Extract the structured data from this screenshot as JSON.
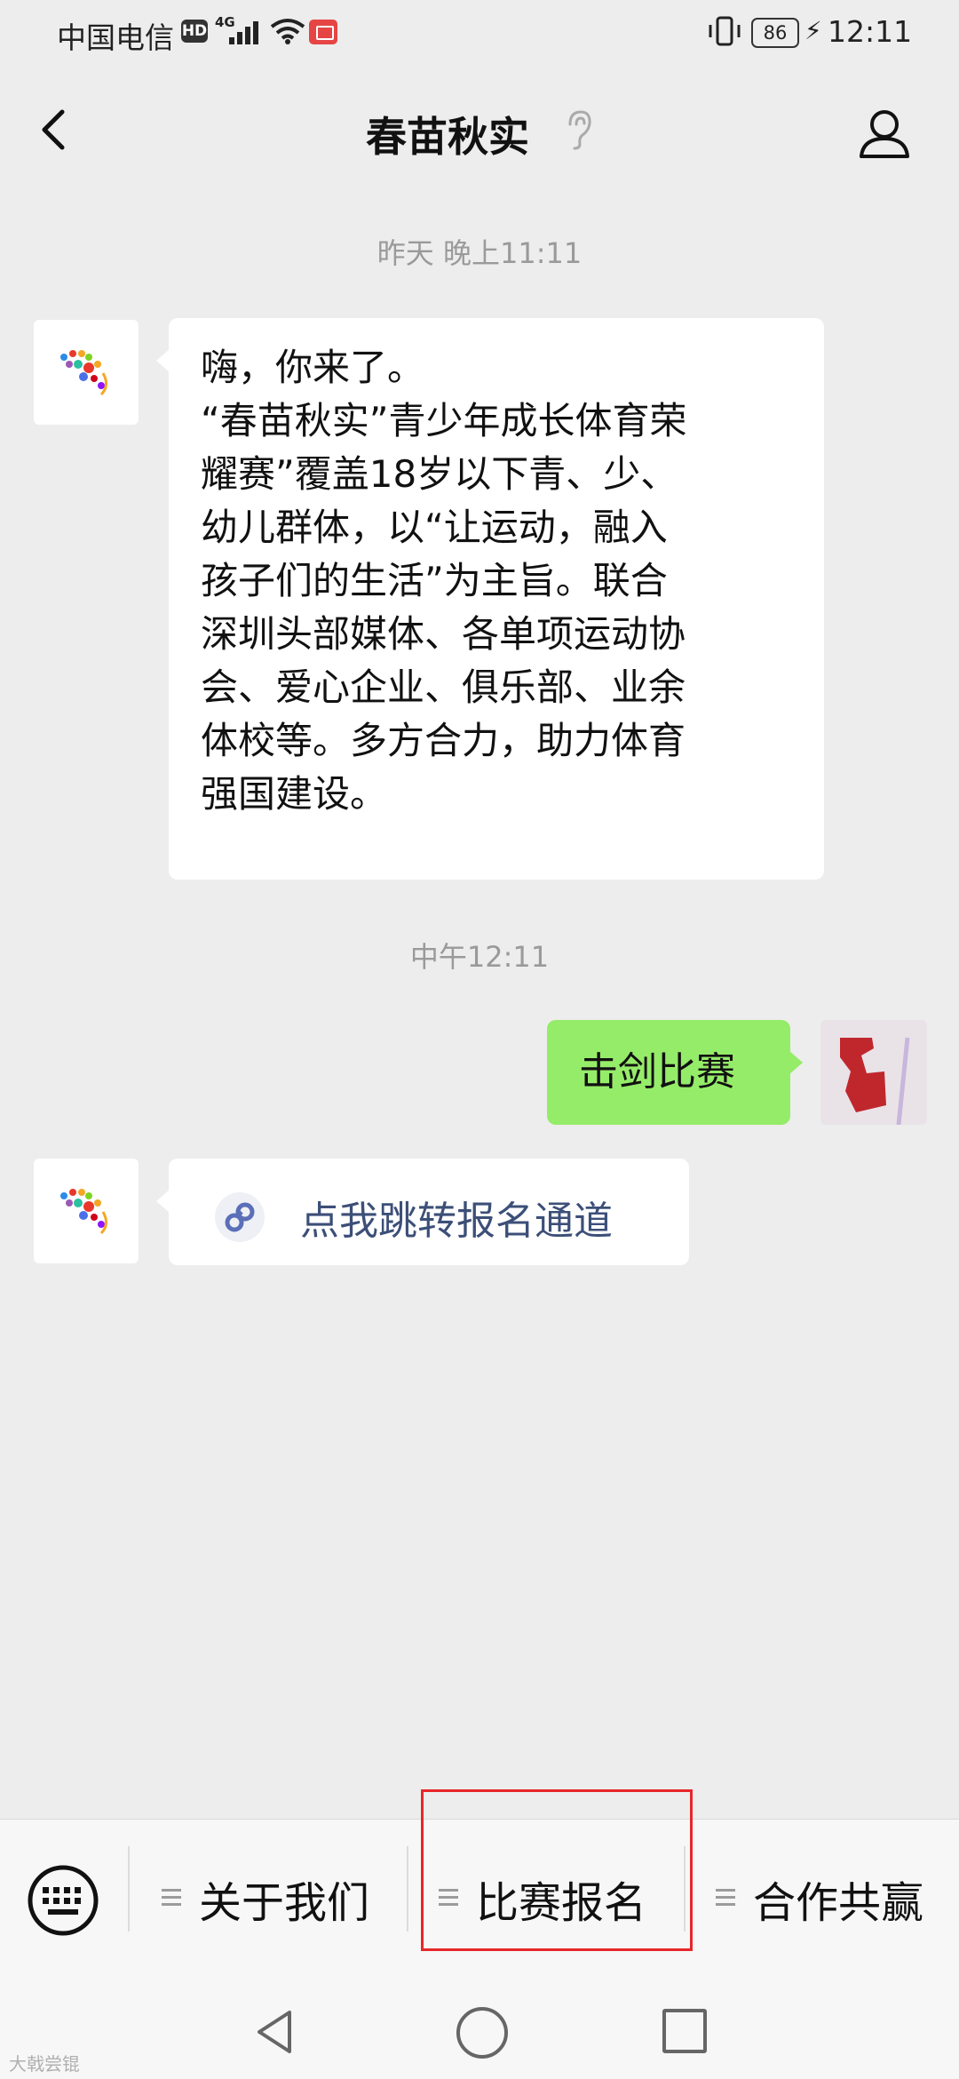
{
  "status_bar": {
    "carrier": "中国电信",
    "hd": "HD",
    "network": "4G",
    "battery": "86",
    "time": "12:11"
  },
  "header": {
    "title": "春苗秋实"
  },
  "messages": {
    "timestamp_1": "昨天 晚上11:11",
    "welcome_lines": [
      "嗨，你来了。",
      "“春苗秋实”青少年成长体育荣",
      "耀赛”覆盖18岁以下青、少、",
      "幼儿群体，以“让运动，融入",
      "孩子们的生活”为主旨。联合",
      "深圳头部媒体、各单项运动协",
      "会、爱心企业、俱乐部、业余",
      "体校等。多方合力，助力体育",
      "强国建设。"
    ],
    "timestamp_2": "中午12:11",
    "user_message": "击剑比赛",
    "link_message": "点我跳转报名通道"
  },
  "bottom_menu": {
    "items": [
      {
        "label": "关于我们"
      },
      {
        "label": "比赛报名"
      },
      {
        "label": "合作共赢"
      }
    ]
  },
  "watermark": "大戟尝锟",
  "colors": {
    "background": "#ededed",
    "sent_bubble": "#95ec69",
    "highlight": "#e8262a"
  }
}
